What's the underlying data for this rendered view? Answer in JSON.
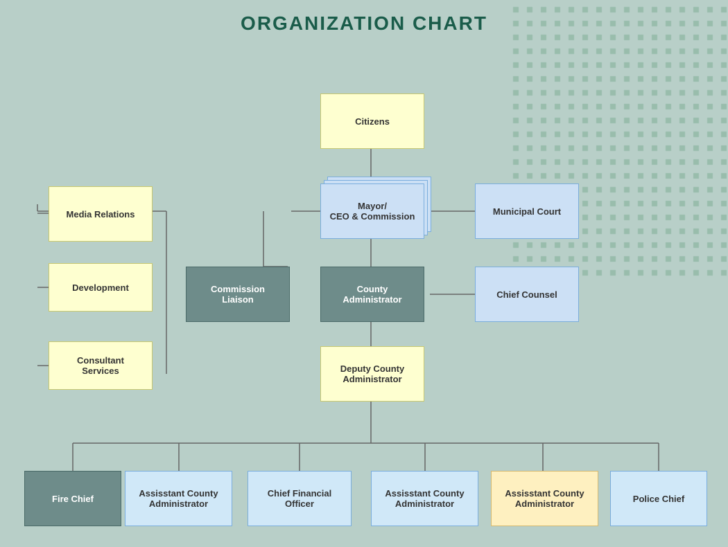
{
  "title": "ORGANIZATION CHART",
  "nodes": {
    "citizens": {
      "label": "Citizens"
    },
    "mayor": {
      "label": "Mayor/\nCEO & Commission"
    },
    "municipal_court": {
      "label": "Municipal Court"
    },
    "media_relations": {
      "label": "Media Relations"
    },
    "development": {
      "label": "Development"
    },
    "consultant_services": {
      "label": "Consultant\nServices"
    },
    "commission_liaison": {
      "label": "Commission\nLiaison"
    },
    "county_administrator": {
      "label": "County\nAdministrator"
    },
    "chief_counsel": {
      "label": "Chief Counsel"
    },
    "deputy_county_admin": {
      "label": "Deputy County\nAdministrator"
    },
    "fire_chief": {
      "label": "Fire Chief"
    },
    "asst_admin_1": {
      "label": "Assisstant County\nAdministrator"
    },
    "chief_financial_officer": {
      "label": "Chief Financial\nOfficer"
    },
    "asst_admin_2": {
      "label": "Assisstant County\nAdministrator"
    },
    "asst_admin_3": {
      "label": "Assisstant County\nAdministrator"
    },
    "police_chief": {
      "label": "Police Chief"
    }
  }
}
